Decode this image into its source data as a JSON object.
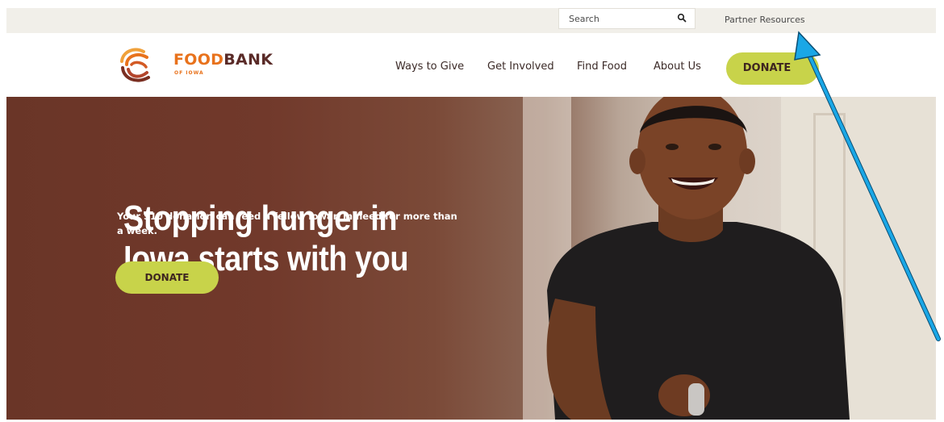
{
  "utility_bar": {
    "search_placeholder": "Search",
    "search_icon": "search-icon",
    "partner_link": "Partner Resources"
  },
  "header": {
    "logo": {
      "name_part1": "FOOD",
      "name_part2": "BANK",
      "subtitle": "OF IOWA",
      "icon": "foodbank-swirl-logo"
    },
    "nav": [
      "Ways to Give",
      "Get Involved",
      "Find Food",
      "About Us"
    ],
    "donate_label": "DONATE"
  },
  "hero": {
    "title_line1": "Stopping hunger in",
    "title_line2": "Iowa starts with you",
    "subtitle": "Your $10 donation can feed a fellow Iowan in need for more than a week.",
    "donate_label": "DONATE",
    "image": "smiling-boy-photo"
  },
  "colors": {
    "accent_green": "#c8d34a",
    "brand_orange": "#e8721c",
    "brand_brown": "#5a2b28",
    "annotation_arrow": "#1aa7e6"
  }
}
